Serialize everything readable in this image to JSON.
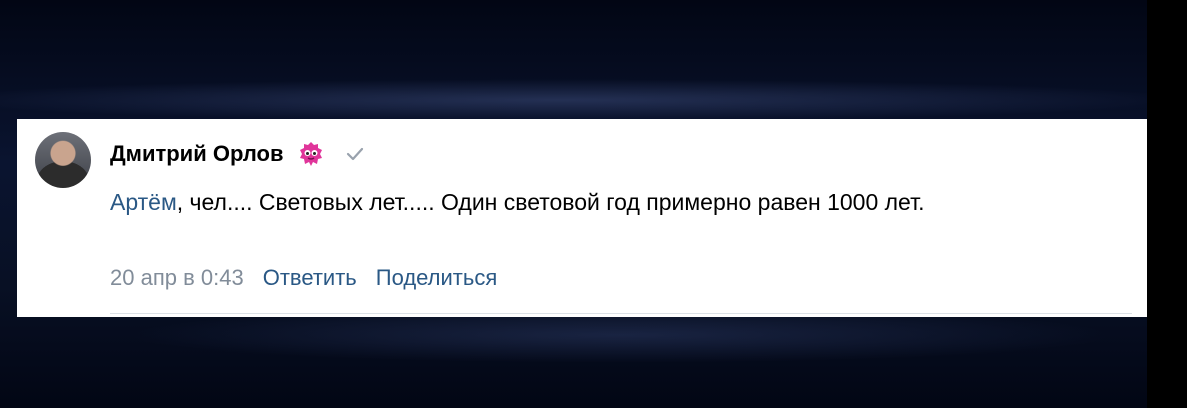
{
  "comment": {
    "author": "Дмитрий Орлов",
    "badge_icon": "pink-monster-badge-icon",
    "check_icon": "checkmark-icon",
    "mention": "Артём",
    "text": ", чел.... Световых лет..... Один световой год примерно равен 1000 лет.",
    "date": "20 апр в 0:43",
    "reply_label": "Ответить",
    "share_label": "Поделиться"
  },
  "colors": {
    "link": "#2a5885",
    "meta": "#818c99",
    "badge": "#e0359a"
  }
}
